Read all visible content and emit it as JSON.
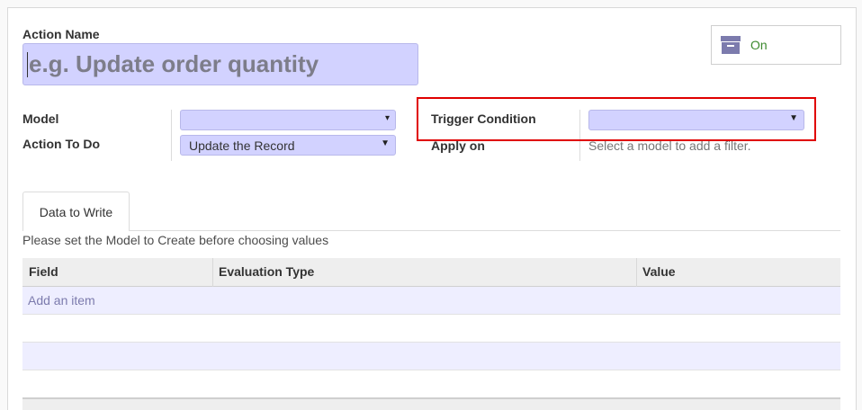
{
  "form": {
    "action_name_label": "Action Name",
    "action_name_placeholder": "e.g. Update order quantity",
    "action_name_value": ""
  },
  "active_toggle": {
    "label": "On",
    "icon": "archive-icon"
  },
  "fields": {
    "model_label": "Model",
    "model_value": "",
    "action_label": "Action To Do",
    "action_value": "Update the Record",
    "trigger_label": "Trigger Condition",
    "trigger_value": "",
    "apply_on_label": "Apply on",
    "apply_on_hint": "Select a model to add a filter."
  },
  "tabs": [
    {
      "label": "Data to Write",
      "active": true
    }
  ],
  "notice": "Please set the Model to Create before choosing values",
  "table": {
    "columns": [
      "Field",
      "Evaluation Type",
      "Value"
    ],
    "add_item_label": "Add an item"
  },
  "colors": {
    "input_bg": "#d2d2ff",
    "highlight": "#e00000",
    "toggle_on": "#3d8a2f",
    "icon": "#7c7bad"
  }
}
